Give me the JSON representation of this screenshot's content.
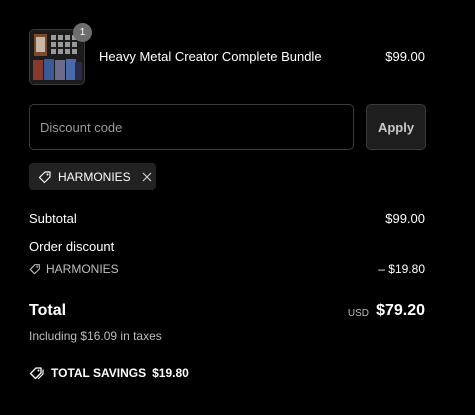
{
  "line_item": {
    "quantity": "1",
    "name": "Heavy Metal Creator Complete Bundle",
    "price": "$99.00",
    "thumbnail_icon": "product-bundle-thumbnail"
  },
  "discount": {
    "placeholder": "Discount code",
    "value": "",
    "apply_label": "Apply",
    "applied_code": "HARMONIES",
    "tag_icon": "tag-icon",
    "remove_icon": "close-icon"
  },
  "summary": {
    "subtotal_label": "Subtotal",
    "subtotal_value": "$99.00",
    "order_discount_label": "Order discount",
    "order_discount_code": "HARMONIES",
    "order_discount_value": "– $19.80",
    "total_label": "Total",
    "currency": "USD",
    "total_value": "$79.20",
    "taxes_note": "Including $16.09 in taxes",
    "savings_label": "TOTAL SAVINGS",
    "savings_value": "$19.80"
  },
  "colors": {
    "background": "#000000",
    "text": "#ffffff",
    "muted_text": "#bdbdbd",
    "border": "#3c3c3c",
    "tag_background": "#222222",
    "badge_background": "#6e6e6e"
  }
}
